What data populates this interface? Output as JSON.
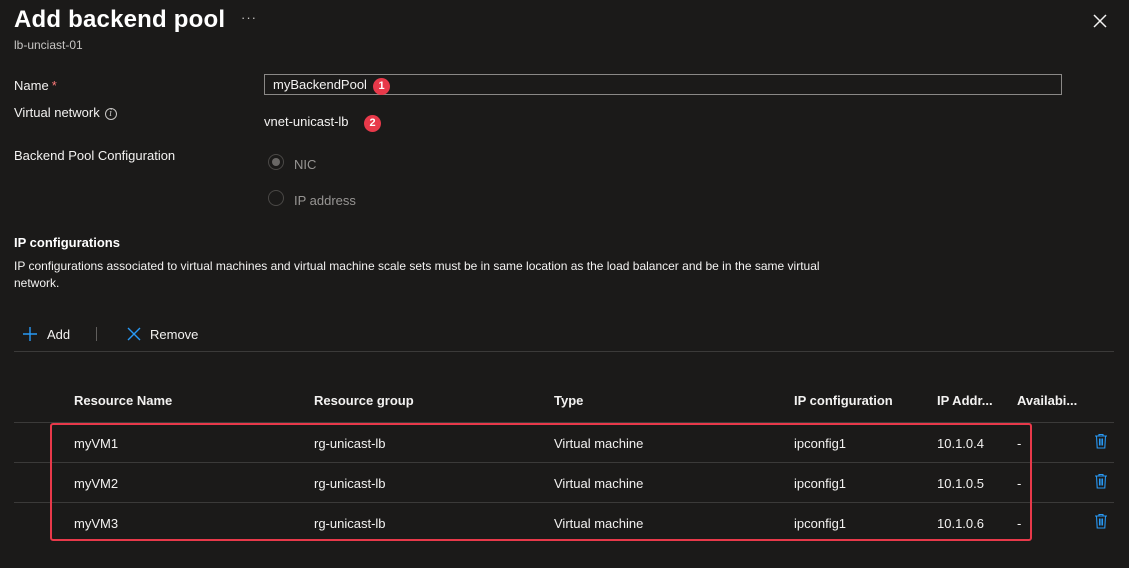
{
  "panel": {
    "title": "Add backend pool",
    "subtitle": "lb-unciast-01",
    "more_label": "···"
  },
  "form": {
    "name_label": "Name",
    "name_required": "*",
    "name_value": "myBackendPool",
    "vnet_label": "Virtual network",
    "vnet_value": "vnet-unicast-lb",
    "pool_config_label": "Backend Pool Configuration",
    "options": [
      {
        "label": "NIC",
        "selected": true,
        "disabled": true
      },
      {
        "label": "IP address",
        "selected": false,
        "disabled": true
      }
    ]
  },
  "badges": [
    "1",
    "2"
  ],
  "ip_section": {
    "title": "IP configurations",
    "description": "IP configurations associated to virtual machines and virtual machine scale sets must be in same location as the load balancer and be in the same virtual network."
  },
  "toolbar": {
    "add_label": "Add",
    "remove_label": "Remove"
  },
  "table": {
    "headers": [
      "Resource Name",
      "Resource group",
      "Type",
      "IP configuration",
      "IP Addr...",
      "Availabi..."
    ],
    "rows": [
      [
        "myVM1",
        "rg-unicast-lb",
        "Virtual machine",
        "ipconfig1",
        "10.1.0.4",
        "-"
      ],
      [
        "myVM2",
        "rg-unicast-lb",
        "Virtual machine",
        "ipconfig1",
        "10.1.0.5",
        "-"
      ],
      [
        "myVM3",
        "rg-unicast-lb",
        "Virtual machine",
        "ipconfig1",
        "10.1.0.6",
        "-"
      ]
    ]
  },
  "colors": {
    "background": "#1b1a19",
    "accent": "#0078d4",
    "annotation": "#e8394a"
  },
  "icons": [
    "close-icon",
    "info-icon",
    "add-icon",
    "remove-icon",
    "trash-icon"
  ]
}
